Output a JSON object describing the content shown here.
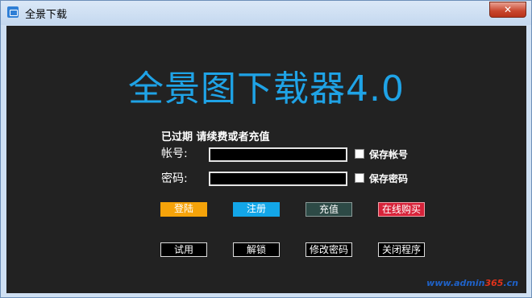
{
  "window": {
    "title": "全景下载",
    "close_label": "✕"
  },
  "main": {
    "headline": "全景图下载器4.0",
    "status": "已过期 请续费或者充值",
    "account_label": "帐号:",
    "account_value": "",
    "password_label": "密码:",
    "password_value": "",
    "save_account_label": "保存帐号",
    "save_password_label": "保存密码"
  },
  "buttons": {
    "login": "登陆",
    "register": "注册",
    "recharge": "充值",
    "buy": "在线购买",
    "trial": "试用",
    "unlock": "解锁",
    "change_password": "修改密码",
    "close_program": "关闭程序"
  },
  "watermark": {
    "prefix": "www.admin",
    "highlight": "365",
    "suffix": ".cn"
  },
  "colors": {
    "headline": "#1fa3e6",
    "login": "#f5a30a",
    "register": "#13a6e8",
    "recharge": "#2d4a46",
    "buy": "#d7233a"
  }
}
